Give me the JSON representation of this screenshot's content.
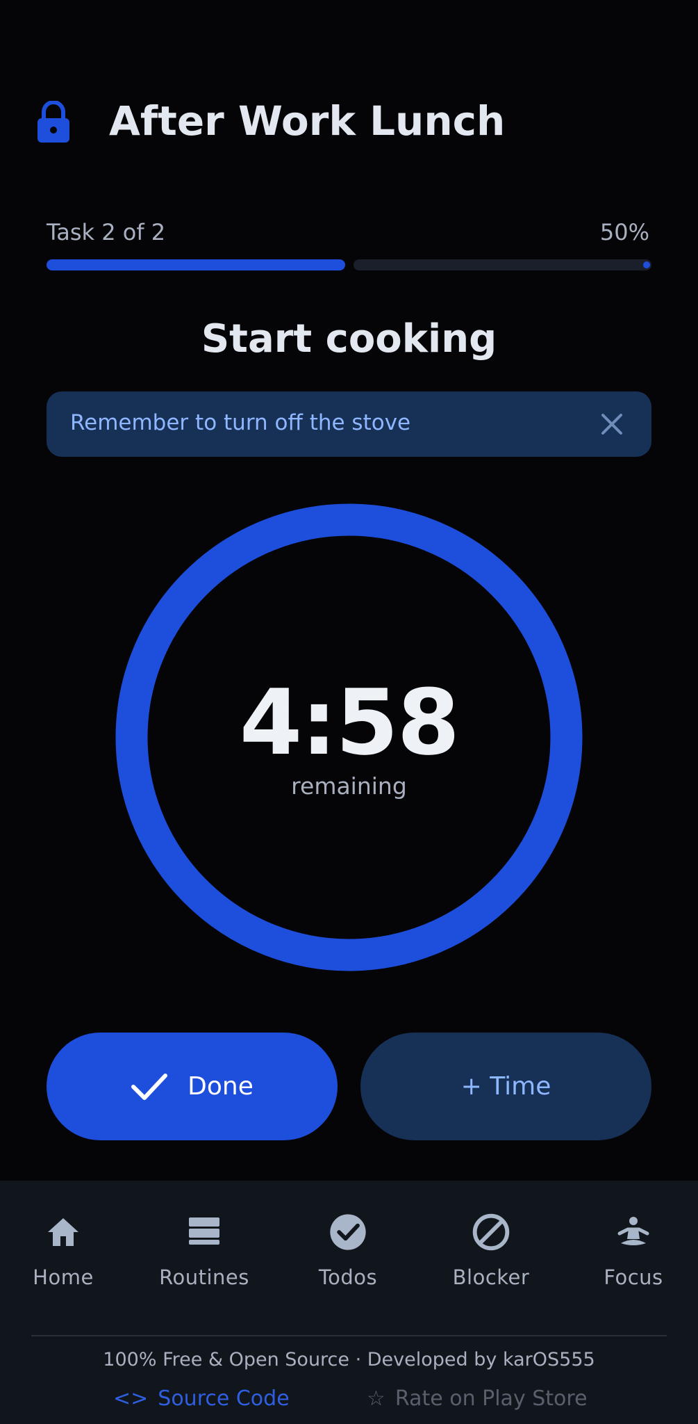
{
  "header": {
    "icon": "lock-icon",
    "title": "After Work Lunch"
  },
  "progress": {
    "label": "Task 2 of 2",
    "percent_text": "50%",
    "fraction": 0.5
  },
  "task": {
    "title": "Start cooking",
    "note": "Remember to turn off the stove"
  },
  "timer": {
    "time": "4:58",
    "label": "remaining"
  },
  "actions": {
    "done_label": "Done",
    "add_time_label": "+ Time"
  },
  "nav": {
    "items": [
      {
        "label": "Home",
        "icon": "home-icon"
      },
      {
        "label": "Routines",
        "icon": "routines-icon"
      },
      {
        "label": "Todos",
        "icon": "check-circle-icon"
      },
      {
        "label": "Blocker",
        "icon": "block-icon"
      },
      {
        "label": "Focus",
        "icon": "meditation-icon"
      }
    ]
  },
  "footer": {
    "text": "100% Free & Open Source · Developed by karOS555",
    "source_code": "Source Code",
    "rate": "Rate on Play Store"
  },
  "colors": {
    "accent": "#1e4fdc",
    "background": "#050507",
    "secondary_button": "#173056",
    "note_text": "#8fb7ff",
    "nav_background": "#11151c"
  }
}
